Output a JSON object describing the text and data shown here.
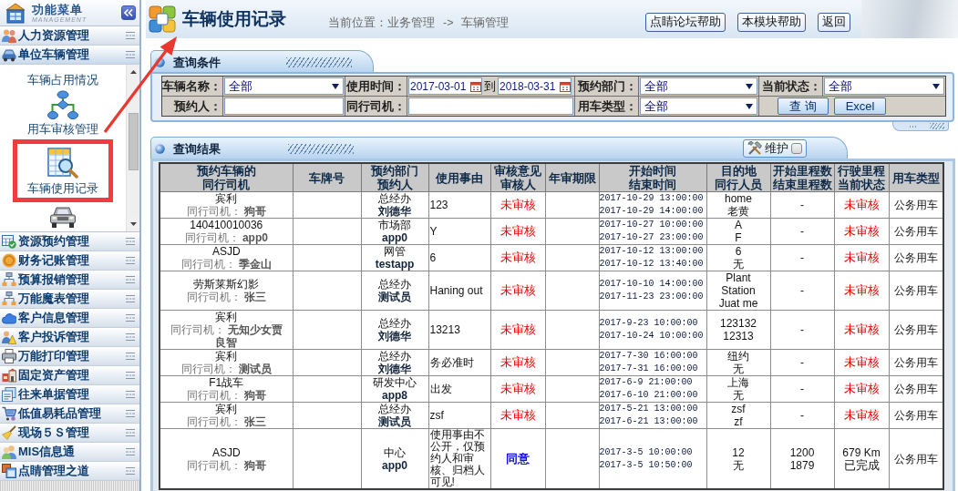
{
  "sidebar": {
    "title": "功能菜单",
    "subtitle": "MANAGEMENT",
    "groups": [
      {
        "label": "人力资源管理",
        "expanded": false
      },
      {
        "label": "单位车辆管理",
        "expanded": true,
        "items": [
          {
            "label": "车辆占用情况",
            "selected": false
          },
          {
            "label": "用车审核管理",
            "selected": false
          },
          {
            "label": "车辆使用记录",
            "selected": true
          },
          {
            "selected": false
          }
        ]
      },
      {
        "label": "资源预约管理",
        "expanded": false
      },
      {
        "label": "财务记账管理",
        "expanded": false
      },
      {
        "label": "预算报销管理",
        "expanded": false
      },
      {
        "label": "万能魔表管理",
        "expanded": false
      },
      {
        "label": "客户信息管理",
        "expanded": false
      },
      {
        "label": "客户投诉管理",
        "expanded": false
      },
      {
        "label": "万能打印管理",
        "expanded": false
      },
      {
        "label": "固定资产管理",
        "expanded": false
      },
      {
        "label": "往来单据管理",
        "expanded": false
      },
      {
        "label": "低值易耗品管理",
        "expanded": false
      },
      {
        "label": "现场５Ｓ管理",
        "expanded": false
      },
      {
        "label": "MIS信息通",
        "expanded": false
      },
      {
        "label": "点睛管理之道",
        "expanded": false
      }
    ]
  },
  "header": {
    "title": "车辆使用记录",
    "breadcrumb": {
      "label": "当前位置：",
      "items": [
        "业务管理",
        "车辆管理"
      ],
      "separator": "->"
    },
    "buttons": [
      "点睛论坛帮助",
      "本模块帮助",
      "返回"
    ]
  },
  "query": {
    "title": "查询条件",
    "rows": [
      {
        "fields": [
          {
            "kind": "select",
            "label": "车辆名称：",
            "value": "全部"
          },
          {
            "kind": "date_range",
            "label": "使用时间：",
            "from": "2017-03-01",
            "joiner": "到",
            "to": "2018-03-31"
          },
          {
            "kind": "select",
            "label": "预约部门：",
            "value": "全部"
          },
          {
            "kind": "select",
            "label": "当前状态：",
            "value": "全部"
          }
        ]
      },
      {
        "fields": [
          {
            "kind": "text",
            "label": "预约人："
          },
          {
            "kind": "text",
            "label": "同行司机："
          },
          {
            "kind": "select",
            "label": "用车类型：",
            "value": "全部"
          }
        ],
        "buttons": [
          "查 询",
          "Excel"
        ]
      }
    ]
  },
  "results": {
    "title": "查询结果",
    "maintain": {
      "label": "维护",
      "checked": false
    },
    "columns": [
      [
        "预约车辆的",
        "同行司机"
      ],
      [
        "车牌号"
      ],
      [
        "预约部门",
        "预约人"
      ],
      [
        "使用事由"
      ],
      [
        "审核意见",
        "审核人"
      ],
      [
        "年审期限"
      ],
      [
        "开始时间",
        "结束时间"
      ],
      [
        "目的地",
        "同行人员"
      ],
      [
        "开始里程数",
        "结束里程数"
      ],
      [
        "行驶里程",
        "当前状态"
      ],
      [
        "用车类型"
      ]
    ],
    "rows": [
      {
        "vehicle": "宾利",
        "driver_line": "同行司机： **狗哥**",
        "department": "总经办",
        "booker": "刘德华",
        "reason": "123",
        "review": "未审核",
        "approved": false,
        "start": "2017-10-29 13:00:00",
        "end": "2017-10-29 14:00:00",
        "destination": "home",
        "companions": "老黄",
        "mileage": [
          "-"
        ],
        "status": "未审核",
        "completed": false,
        "type": "公务用车"
      },
      {
        "vehicle": "140410010036",
        "driver_line": "同行司机： **app0**",
        "department": "市场部",
        "booker": "app0",
        "reason": "Y",
        "review": "未审核",
        "approved": false,
        "start": "2017-10-27 10:00:00",
        "end": "2017-10-27 23:00:00",
        "destination": "A",
        "companions": "F",
        "mileage": [
          "-"
        ],
        "status": "未审核",
        "completed": false,
        "type": "公务用车"
      },
      {
        "vehicle": "ASJD",
        "driver_line": "同行司机： **季金山**",
        "department": "网管",
        "booker": "testapp",
        "reason": "6",
        "review": "未审核",
        "approved": false,
        "start": "2017-10-12 13:00:00",
        "end": "2017-10-12 13:40:00",
        "destination": "6",
        "companions": "无",
        "mileage": [
          "-"
        ],
        "status": "未审核",
        "completed": false,
        "type": "公务用车"
      },
      {
        "vehicle": "劳斯莱斯幻影",
        "driver_line": "同行司机： **张三**",
        "department": "总经办",
        "booker": "测试员",
        "reason": "Haning out",
        "review": "未审核",
        "approved": false,
        "start": "2017-10-10 14:00:00",
        "end": "2017-11-23 23:00:00",
        "destination": "Plant Station",
        "companions": "Juat me",
        "mileage": [
          "-"
        ],
        "status": "未审核",
        "completed": false,
        "type": "公务用车"
      },
      {
        "vehicle": "宾利",
        "driver_line": "同行司机： **无知少女贾良智**",
        "department": "总经办",
        "booker": "刘德华",
        "reason": "13213",
        "review": "未审核",
        "approved": false,
        "start": "2017-9-23 10:00:00",
        "end": "2017-10-24 10:00:00",
        "destination": "123132",
        "companions": "12313",
        "mileage": [
          "-"
        ],
        "status": "未审核",
        "completed": false,
        "type": "公务用车"
      },
      {
        "vehicle": "宾利",
        "driver_line": "同行司机： **测试员**",
        "department": "总经办",
        "booker": "刘德华",
        "reason": "务必准时",
        "review": "未审核",
        "approved": false,
        "start": "2017-7-30 16:00:00",
        "end": "2017-7-31 16:00:00",
        "destination": "纽约",
        "companions": "无",
        "mileage": [
          "-"
        ],
        "status": "未审核",
        "completed": false,
        "type": "公务用车"
      },
      {
        "vehicle": "F1战车",
        "driver_line": "同行司机： **狗哥**",
        "department": "研发中心",
        "booker": "app8",
        "reason": "出发",
        "review": "未审核",
        "approved": false,
        "start": "2017-6-9 21:00:00",
        "end": "2017-6-10 21:00:00",
        "destination": "上海",
        "companions": "无",
        "mileage": [
          "-"
        ],
        "status": "未审核",
        "completed": false,
        "type": "公务用车"
      },
      {
        "vehicle": "宾利",
        "driver_line": "同行司机： **张三**",
        "department": "总经办",
        "booker": "测试员",
        "reason": "zsf",
        "review": "未审核",
        "approved": false,
        "start": "2017-5-21 13:00:00",
        "end": "2017-6-21 13:00:00",
        "destination": "zsf",
        "companions": "zf",
        "mileage": [
          "-"
        ],
        "status": "未审核",
        "completed": false,
        "type": "公务用车"
      },
      {
        "vehicle": "ASJD",
        "driver_line": "同行司机： **狗哥**",
        "department": "中心",
        "booker": "app0",
        "reason": "使用事由不公开，仅预约人和审核、归档人可见!",
        "review": "同意",
        "approved": true,
        "start": "2017-3-5 10:00:00",
        "end": "2017-3-5 10:50:00",
        "destination": "12",
        "companions": "无",
        "mileage": [
          "1200",
          "1879"
        ],
        "distance": "679 Km",
        "status": "已完成",
        "completed": true,
        "type": "公务用车"
      }
    ]
  }
}
